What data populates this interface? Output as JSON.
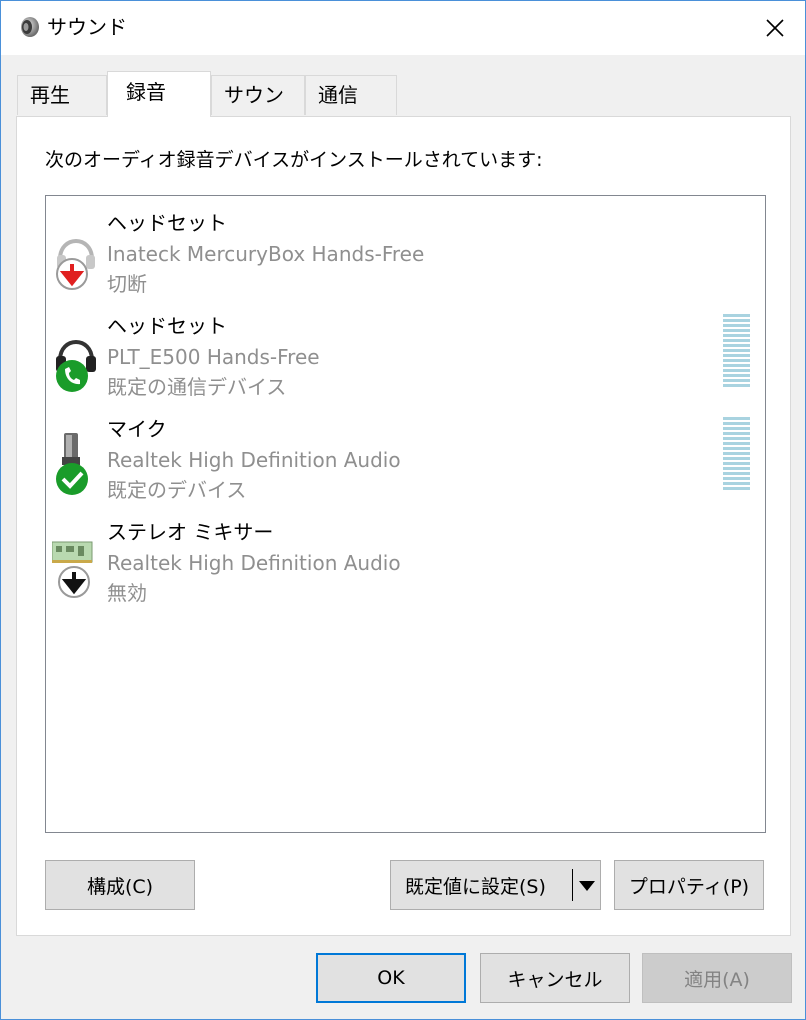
{
  "window": {
    "title": "サウンド",
    "title_icon": "speaker-icon",
    "close_icon": "close-icon"
  },
  "tabs": [
    {
      "label": "再生",
      "selected": false
    },
    {
      "label": "録音",
      "selected": true
    },
    {
      "label": "サウンド",
      "selected": false
    },
    {
      "label": "通信",
      "selected": false
    }
  ],
  "panel": {
    "description": "次のオーディオ録音デバイスがインストールされています:"
  },
  "devices": [
    {
      "name": "ヘッドセット",
      "description": "Inateck MercuryBox Hands-Free",
      "status": "切断",
      "icon": "headset-icon",
      "badge": "red-down-arrow-icon",
      "level_meter": false
    },
    {
      "name": "ヘッドセット",
      "description": "PLT_E500 Hands-Free",
      "status": "既定の通信デバイス",
      "icon": "headset-icon",
      "badge": "green-phone-icon",
      "level_meter": true
    },
    {
      "name": "マイク",
      "description": "Realtek High Definition Audio",
      "status": "既定のデバイス",
      "icon": "microphone-icon",
      "badge": "green-check-icon",
      "level_meter": true
    },
    {
      "name": "ステレオ ミキサー",
      "description": "Realtek High Definition Audio",
      "status": "無効",
      "icon": "sound-card-icon",
      "badge": "black-down-arrow-icon",
      "level_meter": false
    }
  ],
  "buttons": {
    "configure": "構成(C)",
    "set_default": "既定値に設定(S)",
    "properties": "プロパティ(P)",
    "ok": "OK",
    "cancel": "キャンセル",
    "apply": "適用(A)"
  },
  "colors": {
    "accent": "#0078d7",
    "meter": "#a9d3e0",
    "ok_green": "#1a9c2a",
    "disconnect_red": "#e02020"
  }
}
